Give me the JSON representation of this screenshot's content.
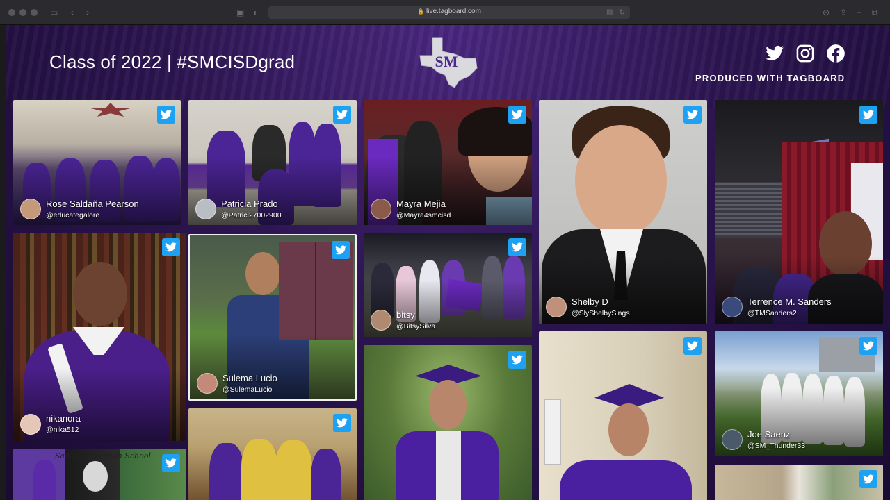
{
  "browser": {
    "url": "live.tagboard.com"
  },
  "header": {
    "title": "Class of 2022 | #SMCISDgrad",
    "logo_text": "SM",
    "produced": "PRODUCED WITH TAGBOARD",
    "social": [
      "twitter-icon",
      "instagram-icon",
      "facebook-icon"
    ]
  },
  "colors": {
    "brand_purple": "#3a1c6e",
    "twitter_blue": "#1da1f2"
  },
  "posts": [
    {
      "name": "Rose Saldaña Pearson",
      "handle": "@educategalore"
    },
    {
      "name": "Patricia Prado",
      "handle": "@Patrici27002900"
    },
    {
      "name": "Mayra Mejia",
      "handle": "@Mayra4smcisd"
    },
    {
      "name": "Shelby D",
      "handle": "@SlyShelbySings"
    },
    {
      "name": "Terrence M. Sanders",
      "handle": "@TMSanders2"
    },
    {
      "name": "nikanora",
      "handle": "@nika512"
    },
    {
      "name": "Sulema Lucio",
      "handle": "@SulemaLucio"
    },
    {
      "name": "bitsy",
      "handle": "@BitsySilva"
    },
    {
      "name": "Joe Saenz",
      "handle": "@SM_Thunder33"
    }
  ],
  "photo_captions": {
    "smhs_banner": "San Marcos High School"
  }
}
